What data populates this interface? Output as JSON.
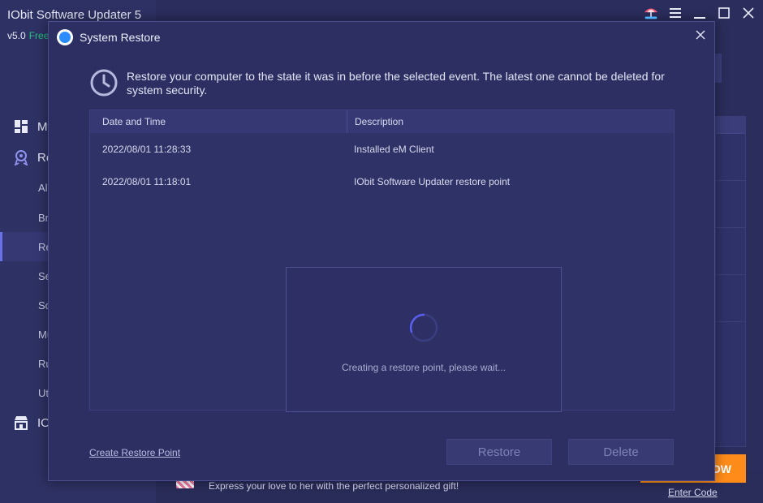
{
  "app": {
    "title": "IObit Software Updater 5",
    "version": "v5.0",
    "edition": "Free",
    "nav": [
      {
        "label": "My",
        "icon": "dashboard-icon"
      },
      {
        "label": "Re",
        "icon": "rescue-icon"
      },
      {
        "label": "IO",
        "icon": "store-icon"
      }
    ],
    "subnav": [
      "Al",
      "Br",
      "Re",
      "Se",
      "So",
      "Mu",
      "Ru",
      "Ut"
    ],
    "promo_text": "Express your love to her with the perfect personalized gift!",
    "buy_label": "OW",
    "enter_code": "Enter Code"
  },
  "dialog": {
    "title": "System Restore",
    "description": "Restore your computer to the state it was in before the selected event. The latest one cannot be deleted for system security.",
    "columns": [
      "Date and Time",
      "Description"
    ],
    "rows": [
      {
        "datetime": "2022/08/01 11:28:33",
        "description": "Installed eM Client"
      },
      {
        "datetime": "2022/08/01 11:18:01",
        "description": "IObit Software Updater restore point"
      }
    ],
    "loading_text": "Creating a restore point, please wait...",
    "create_link": "Create Restore Point",
    "restore_label": "Restore",
    "delete_label": "Delete"
  },
  "colors": {
    "accent": "#6c70e6",
    "buy": "#ff8c1a",
    "free": "#26c281"
  }
}
